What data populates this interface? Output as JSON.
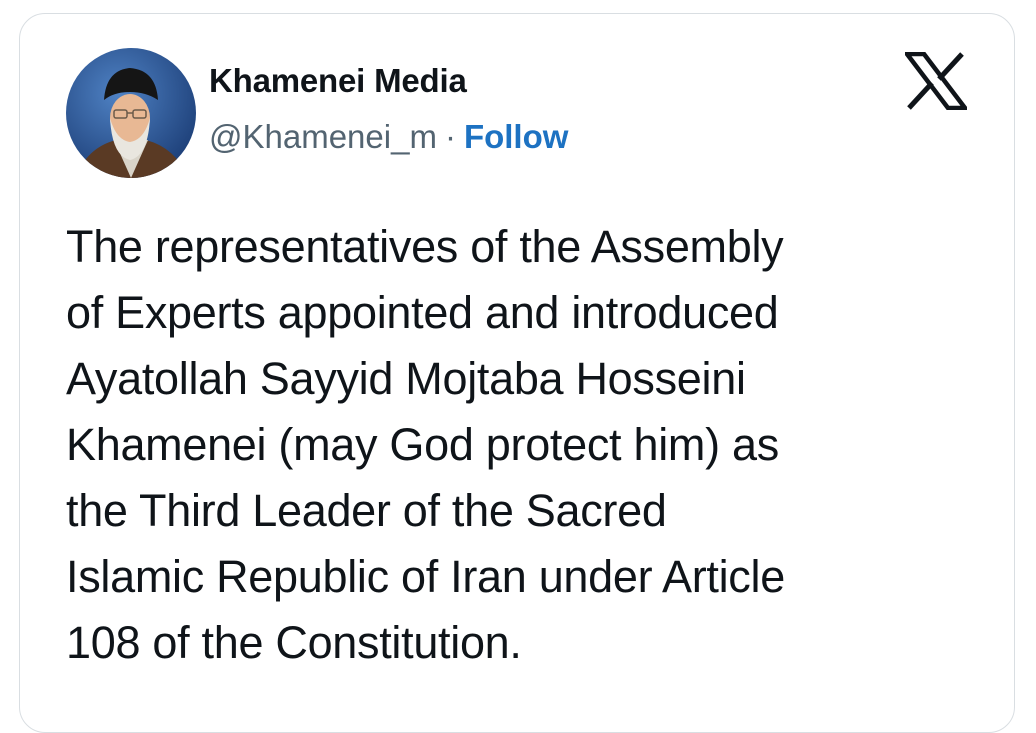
{
  "post": {
    "author": {
      "display_name": "Khamenei Media",
      "handle": "@Khamenei_m",
      "separator": "·",
      "follow_label": "Follow"
    },
    "platform_icon": "x-logo-icon",
    "avatar_icon": "profile-photo-avatar",
    "text_lines": [
      "The representatives of the Assembly",
      "of Experts appointed and introduced",
      "Ayatollah Sayyid Mojtaba Hosseini",
      "Khamenei (may God protect him) as",
      "the Third Leader of the Sacred",
      "Islamic Republic of Iran under Article",
      "108 of the Constitution."
    ]
  },
  "colors": {
    "text_primary": "#0f1419",
    "text_secondary": "#536471",
    "follow_link": "#1d72c2",
    "card_border": "#d9dee2"
  }
}
